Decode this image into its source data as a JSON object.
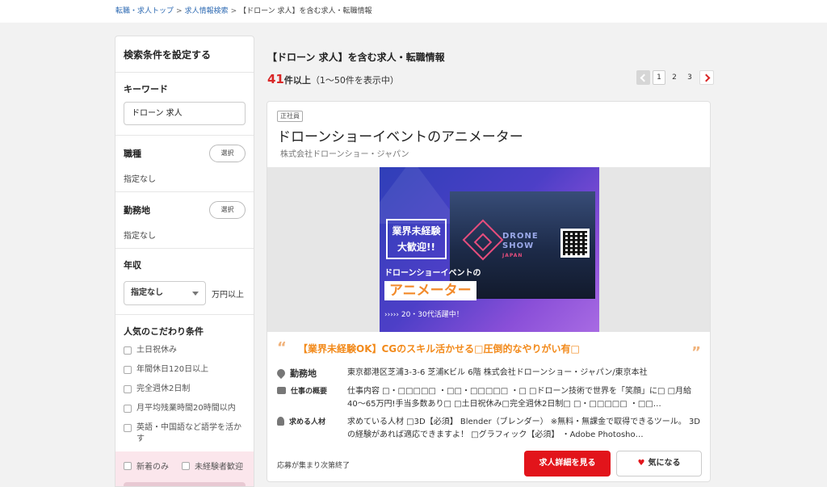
{
  "breadcrumb": {
    "item1": "転職・求人トップ",
    "sep": ">",
    "item2": "求人情報検索",
    "current": "【ドローン 求人】を含む求人・転職情報"
  },
  "sidebar": {
    "heading": "検索条件を設定する",
    "keyword": {
      "label": "キーワード",
      "value": "ドローン 求人"
    },
    "jobtype": {
      "label": "職種",
      "button": "選択",
      "value": "指定なし"
    },
    "location": {
      "label": "勤務地",
      "button": "選択",
      "value": "指定なし"
    },
    "salary": {
      "label": "年収",
      "selected": "指定なし",
      "unit": "万円以上"
    },
    "preferences": {
      "label": "人気のこだわり条件",
      "items": [
        "土日祝休み",
        "年間休日120日以上",
        "完全週休2日制",
        "月平均残業時間20時間以内",
        "英語・中国語など語学を活かす"
      ]
    },
    "quick": {
      "new": "新着のみ",
      "inexperienced": "未経験者歓迎"
    }
  },
  "main": {
    "title": "【ドローン 求人】を含む求人・転職情報",
    "count_num": "41",
    "count_suffix": "件以上",
    "count_range": "（1〜50件を表示中）",
    "pages": [
      "1",
      "2",
      "3"
    ]
  },
  "job": {
    "badge": "正社員",
    "title": "ドローンショーイベントのアニメーター",
    "company": "株式会社ドローンショー・ジャパン",
    "banner": {
      "inexperienced": "業界未経験\n大歓迎!!",
      "brand_line1": "DRONE",
      "brand_line2": "SHOW",
      "brand_line3": "JAPAN",
      "subtitle": "ドローンショーイベントの",
      "headline": "アニメーター",
      "footer": "››››› 20・30代活躍中！"
    },
    "catch_copy": "【業界未経験OK】CGのスキル活かせる□圧倒的なやりがい有□",
    "quote_open": "“",
    "quote_close": "”",
    "location": {
      "label": "勤務地",
      "value": "東京都港区芝浦3-3-6 芝浦Kビル 6階 株式会社ドローンショー・ジャパン/東京本社"
    },
    "work": {
      "label": "仕事の概要",
      "value": "仕事内容 □・□□□□□ ・□□・□□□□□ ・□ □ドローン技術で世界を「笑顔」に□ □月給40〜65万円!手当多数あり□ □土日祝休み□完全週休2日制□ □・□□□□□ ・□□…"
    },
    "talent": {
      "label": "求める人材",
      "value": "求めている人材 □3D【必須】 Blender（ブレンダー） ※無料・無課金で取得できるツール。 3Dの経験があれば適応できますよ！ □グラフィック【必須】 ・Adobe Photosho…"
    },
    "status": "応募が集まり次第終了",
    "detail_button": "求人詳細を見る",
    "fav_button": "気になる"
  }
}
